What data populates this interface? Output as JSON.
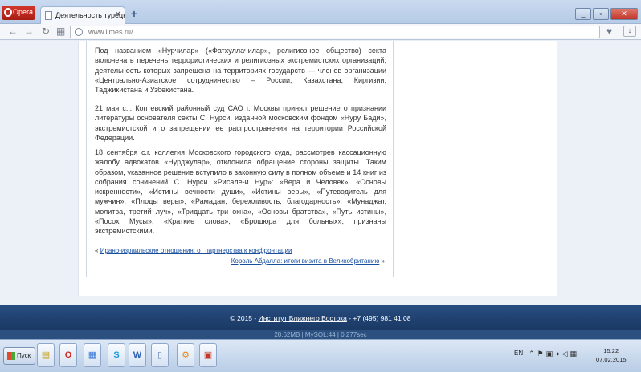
{
  "browser": {
    "app_button": "Opera",
    "tab_title": "Деятельность турецкой ре",
    "url": "www.iimes.ru/"
  },
  "article": {
    "paragraphs": [
      "Под названием «Нурчилар» («Фатхуллачилар», религиозное общество) секта включена в перечень террористических и религиозных экстремистских организаций, деятельность которых запрещена на территориях государств — членов организации «Центрально-Азиатское сотрудничество – России, Казахстана, Киргизии, Таджикистана и Узбекистана.",
      "21 мая с.г. Коптевский районный суд САО г. Москвы принял решение о признании литературы основателя секты С. Нурси, изданной московским фондом «Нуру Бади», экстремистской и о запрещении ее распространения на территории Российской Федерации.",
      "18 сентября с.г. коллегия Московского городского суда, рассмотрев кассационную жалобу адвокатов «Нурджулар», отклонила обращение стороны защиты. Таким образом, указанное решение вступило в законную силу в полном объеме и 14 книг из собрания сочинений С. Нурси «Рисале-и Нур»: «Вера и Человек», «Основы искренности», «Истины вечности души», «Истины веры», «Путеводитель для мужчин», «Плоды веры», «Рамадан, бережливость, благодарность», «Мунаджат, молитва, третий луч», «Тридцать три окна», «Основы братства», «Путь истины», «Посох Мусы», «Краткие слова», «Брошюра для больных», признаны экстремистскими."
    ],
    "prev_marker": "«",
    "prev_link": "Ирано-израильские отношения: от партнерства к конфронтации",
    "next_link": "Король Абдалла: итоги визита в Великобританию",
    "next_marker": "»"
  },
  "footer": {
    "copyright_prefix": "© 2015 - ",
    "institute_link": "Институт Ближнего Востока",
    "phone": " - +7 (495) 981 41 08",
    "stats": "28.62MB | MySQL:44 | 0.277sec"
  },
  "taskbar": {
    "start_label": "Пуск",
    "language": "EN",
    "time": "15:22",
    "date": "07.02.2015"
  }
}
